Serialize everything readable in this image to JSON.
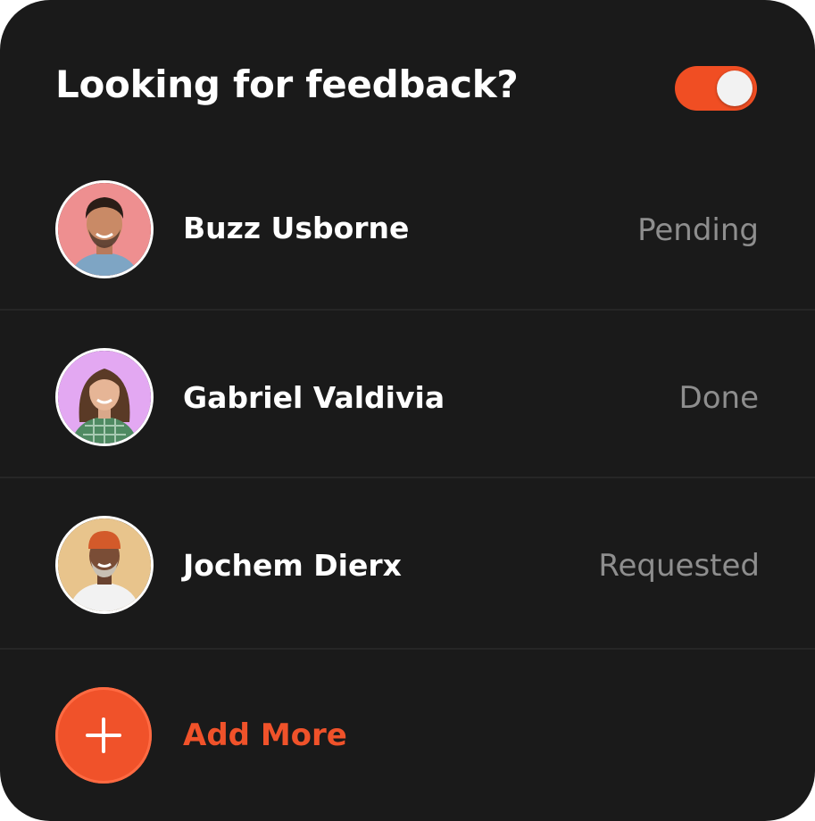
{
  "header": {
    "title": "Looking for feedback?",
    "toggle_on": true
  },
  "people": [
    {
      "name": "Buzz Usborne",
      "status": "Pending",
      "avatar_bg": "#ee8f90"
    },
    {
      "name": "Gabriel Valdivia",
      "status": "Done",
      "avatar_bg": "#e3a8f2"
    },
    {
      "name": "Jochem Dierx",
      "status": "Requested",
      "avatar_bg": "#e8c48c"
    }
  ],
  "add": {
    "label": "Add More"
  },
  "colors": {
    "accent": "#f0522a",
    "background": "#1a1a1a",
    "status_text": "#8e8e8e"
  }
}
